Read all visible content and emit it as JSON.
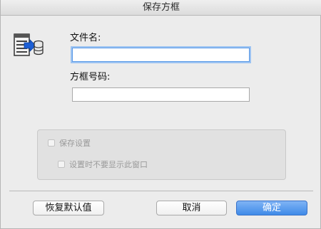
{
  "window": {
    "title": "保存方框"
  },
  "icons": {
    "dialog_icon": "save-box-icon"
  },
  "form": {
    "filename_label": "文件名:",
    "filename_value": "",
    "box_number_label": "方框号码:",
    "box_number_value": ""
  },
  "settings_group": {
    "save_settings_label": "保存设置",
    "save_settings_checked": false,
    "dont_show_label": "设置时不要显示此窗口",
    "dont_show_checked": false
  },
  "buttons": {
    "restore_defaults": "恢复默认值",
    "cancel": "取消",
    "ok": "确定"
  },
  "colors": {
    "primary_button": "#3f8be8",
    "focus_ring": "#9cc3f2"
  }
}
